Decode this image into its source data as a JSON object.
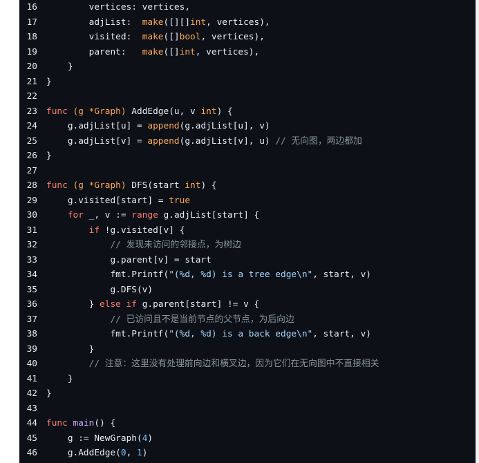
{
  "colors": {
    "background": "#0d1117",
    "text": "#e6edf3",
    "keyword": "#ff7b72",
    "function": "#d2a8ff",
    "type": "#ffa657",
    "string": "#a5d6ff",
    "number": "#79c0ff",
    "comment": "#8b949e"
  },
  "code": {
    "lines": [
      {
        "num": "16",
        "tokens": [
          {
            "t": "ident",
            "v": "        vertices: vertices,"
          }
        ]
      },
      {
        "num": "17",
        "tokens": [
          {
            "t": "ident",
            "v": "        adjList:  "
          },
          {
            "t": "builtin",
            "v": "make"
          },
          {
            "t": "op",
            "v": "([][]"
          },
          {
            "t": "ty",
            "v": "int"
          },
          {
            "t": "op",
            "v": ", vertices),"
          }
        ]
      },
      {
        "num": "18",
        "tokens": [
          {
            "t": "ident",
            "v": "        visited:  "
          },
          {
            "t": "builtin",
            "v": "make"
          },
          {
            "t": "op",
            "v": "([]"
          },
          {
            "t": "ty",
            "v": "bool"
          },
          {
            "t": "op",
            "v": ", vertices),"
          }
        ]
      },
      {
        "num": "19",
        "tokens": [
          {
            "t": "ident",
            "v": "        parent:   "
          },
          {
            "t": "builtin",
            "v": "make"
          },
          {
            "t": "op",
            "v": "([]"
          },
          {
            "t": "ty",
            "v": "int"
          },
          {
            "t": "op",
            "v": ", vertices),"
          }
        ]
      },
      {
        "num": "20",
        "tokens": [
          {
            "t": "op",
            "v": "    }"
          }
        ]
      },
      {
        "num": "21",
        "tokens": [
          {
            "t": "op",
            "v": "}"
          }
        ]
      },
      {
        "num": "22",
        "tokens": [
          {
            "t": "op",
            "v": ""
          }
        ]
      },
      {
        "num": "23",
        "tokens": [
          {
            "t": "kw",
            "v": "func"
          },
          {
            "t": "op",
            "v": " "
          },
          {
            "t": "param",
            "v": "(g *Graph)"
          },
          {
            "t": "op",
            "v": " AddEdge(u, v "
          },
          {
            "t": "ty",
            "v": "int"
          },
          {
            "t": "op",
            "v": ") {"
          }
        ]
      },
      {
        "num": "24",
        "tokens": [
          {
            "t": "op",
            "v": "    g.adjList[u] = "
          },
          {
            "t": "builtin",
            "v": "append"
          },
          {
            "t": "op",
            "v": "(g.adjList[u], v)"
          }
        ]
      },
      {
        "num": "25",
        "tokens": [
          {
            "t": "op",
            "v": "    g.adjList[v] = "
          },
          {
            "t": "builtin",
            "v": "append"
          },
          {
            "t": "op",
            "v": "(g.adjList[v], u) "
          },
          {
            "t": "com",
            "v": "// 无向图，两边都加"
          }
        ]
      },
      {
        "num": "26",
        "tokens": [
          {
            "t": "op",
            "v": "}"
          }
        ]
      },
      {
        "num": "27",
        "tokens": [
          {
            "t": "op",
            "v": ""
          }
        ]
      },
      {
        "num": "28",
        "tokens": [
          {
            "t": "kw",
            "v": "func"
          },
          {
            "t": "op",
            "v": " "
          },
          {
            "t": "param",
            "v": "(g *Graph)"
          },
          {
            "t": "op",
            "v": " DFS(start "
          },
          {
            "t": "ty",
            "v": "int"
          },
          {
            "t": "op",
            "v": ") {"
          }
        ]
      },
      {
        "num": "29",
        "tokens": [
          {
            "t": "op",
            "v": "    g.visited[start] = "
          },
          {
            "t": "bool",
            "v": "true"
          }
        ]
      },
      {
        "num": "30",
        "tokens": [
          {
            "t": "op",
            "v": "    "
          },
          {
            "t": "kw",
            "v": "for"
          },
          {
            "t": "op",
            "v": " _, v := "
          },
          {
            "t": "kw",
            "v": "range"
          },
          {
            "t": "op",
            "v": " g.adjList[start] {"
          }
        ]
      },
      {
        "num": "31",
        "tokens": [
          {
            "t": "op",
            "v": "        "
          },
          {
            "t": "kw",
            "v": "if"
          },
          {
            "t": "op",
            "v": " !g.visited[v] {"
          }
        ]
      },
      {
        "num": "32",
        "tokens": [
          {
            "t": "op",
            "v": "            "
          },
          {
            "t": "com",
            "v": "// 发现未访问的邻接点，为树边"
          }
        ]
      },
      {
        "num": "33",
        "tokens": [
          {
            "t": "op",
            "v": "            g.parent[v] = start"
          }
        ]
      },
      {
        "num": "34",
        "tokens": [
          {
            "t": "op",
            "v": "            fmt.Printf("
          },
          {
            "t": "str",
            "v": "\"(%d, %d) is a tree edge\\n\""
          },
          {
            "t": "op",
            "v": ", start, v)"
          }
        ]
      },
      {
        "num": "35",
        "tokens": [
          {
            "t": "op",
            "v": "            g.DFS(v)"
          }
        ]
      },
      {
        "num": "36",
        "tokens": [
          {
            "t": "op",
            "v": "        } "
          },
          {
            "t": "kw",
            "v": "else"
          },
          {
            "t": "op",
            "v": " "
          },
          {
            "t": "kw",
            "v": "if"
          },
          {
            "t": "op",
            "v": " g.parent[start] != v {"
          }
        ]
      },
      {
        "num": "37",
        "tokens": [
          {
            "t": "op",
            "v": "            "
          },
          {
            "t": "com",
            "v": "// 已访问且不是当前节点的父节点，为后向边"
          }
        ]
      },
      {
        "num": "38",
        "tokens": [
          {
            "t": "op",
            "v": "            fmt.Printf("
          },
          {
            "t": "str",
            "v": "\"(%d, %d) is a back edge\\n\""
          },
          {
            "t": "op",
            "v": ", start, v)"
          }
        ]
      },
      {
        "num": "39",
        "tokens": [
          {
            "t": "op",
            "v": "        }"
          }
        ]
      },
      {
        "num": "40",
        "tokens": [
          {
            "t": "op",
            "v": "        "
          },
          {
            "t": "com",
            "v": "// 注意：这里没有处理前向边和横叉边，因为它们在无向图中不直接相关"
          }
        ]
      },
      {
        "num": "41",
        "tokens": [
          {
            "t": "op",
            "v": "    }"
          }
        ]
      },
      {
        "num": "42",
        "tokens": [
          {
            "t": "op",
            "v": "}"
          }
        ]
      },
      {
        "num": "43",
        "tokens": [
          {
            "t": "op",
            "v": ""
          }
        ]
      },
      {
        "num": "44",
        "tokens": [
          {
            "t": "kw",
            "v": "func"
          },
          {
            "t": "op",
            "v": " "
          },
          {
            "t": "fn",
            "v": "main"
          },
          {
            "t": "op",
            "v": "() {"
          }
        ]
      },
      {
        "num": "45",
        "tokens": [
          {
            "t": "op",
            "v": "    g := NewGraph("
          },
          {
            "t": "num",
            "v": "4"
          },
          {
            "t": "op",
            "v": ")"
          }
        ]
      },
      {
        "num": "46",
        "tokens": [
          {
            "t": "op",
            "v": "    g.AddEdge("
          },
          {
            "t": "num",
            "v": "0"
          },
          {
            "t": "op",
            "v": ", "
          },
          {
            "t": "num",
            "v": "1"
          },
          {
            "t": "op",
            "v": ")"
          }
        ]
      }
    ]
  }
}
